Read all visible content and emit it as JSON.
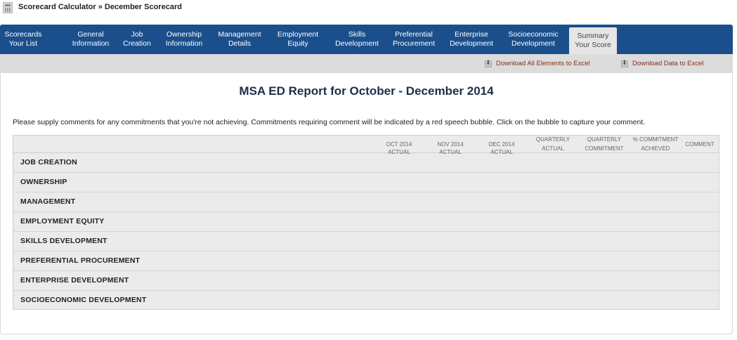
{
  "breadcrumb": {
    "text": "Scorecard Calculator » December Scorecard"
  },
  "nav": {
    "tabs": [
      {
        "line1": "Scorecards",
        "line2": "Your List"
      },
      {
        "line1": "General",
        "line2": "Information"
      },
      {
        "line1": "Job",
        "line2": "Creation"
      },
      {
        "line1": "Ownership",
        "line2": "Information"
      },
      {
        "line1": "Management",
        "line2": "Details"
      },
      {
        "line1": "Employment",
        "line2": "Equity"
      },
      {
        "line1": "Skills",
        "line2": "Development"
      },
      {
        "line1": "Preferential",
        "line2": "Procurement"
      },
      {
        "line1": "Enterprise",
        "line2": "Development"
      },
      {
        "line1": "Socioeconomic",
        "line2": "Development"
      },
      {
        "line1": "Summary",
        "line2": "Your Score"
      }
    ],
    "active_tab": "Summary"
  },
  "toolbar": {
    "download_all": "Download All Elements to Excel",
    "download_data": "Download Data to Excel"
  },
  "report": {
    "title": "MSA ED Report for October - December 2014",
    "instructions": "Please supply comments for any commitments that you're not achieving. Commitments requiring comment will be indicated by a red speech bubble. Click on the bubble to capture your comment."
  },
  "table": {
    "headers": {
      "oct": "OCT 2014 ACTUAL",
      "nov": "NOV 2014 ACTUAL",
      "dec": "DEC 2014 ACTUAL",
      "q_actual_1": "QUARTERLY",
      "q_actual_2": "ACTUAL",
      "q_commit_1": "QUARTERLY",
      "q_commit_2": "COMMITMENT",
      "pct_1": "% COMMITMENT",
      "pct_2": "ACHIEVED",
      "comment": "COMMENT"
    },
    "rows": [
      "JOB CREATION",
      "OWNERSHIP",
      "MANAGEMENT",
      "EMPLOYMENT EQUITY",
      "SKILLS DEVELOPMENT",
      "PREFERENTIAL PROCUREMENT",
      "ENTERPRISE DEVELOPMENT",
      "SOCIOECONOMIC DEVELOPMENT"
    ]
  },
  "colors": {
    "nav_bg": "#1b4f8c",
    "active_tab_bg": "#e6e6e6",
    "toolbar_bg": "#dcdcdc",
    "link_color": "#8a2a1a"
  }
}
